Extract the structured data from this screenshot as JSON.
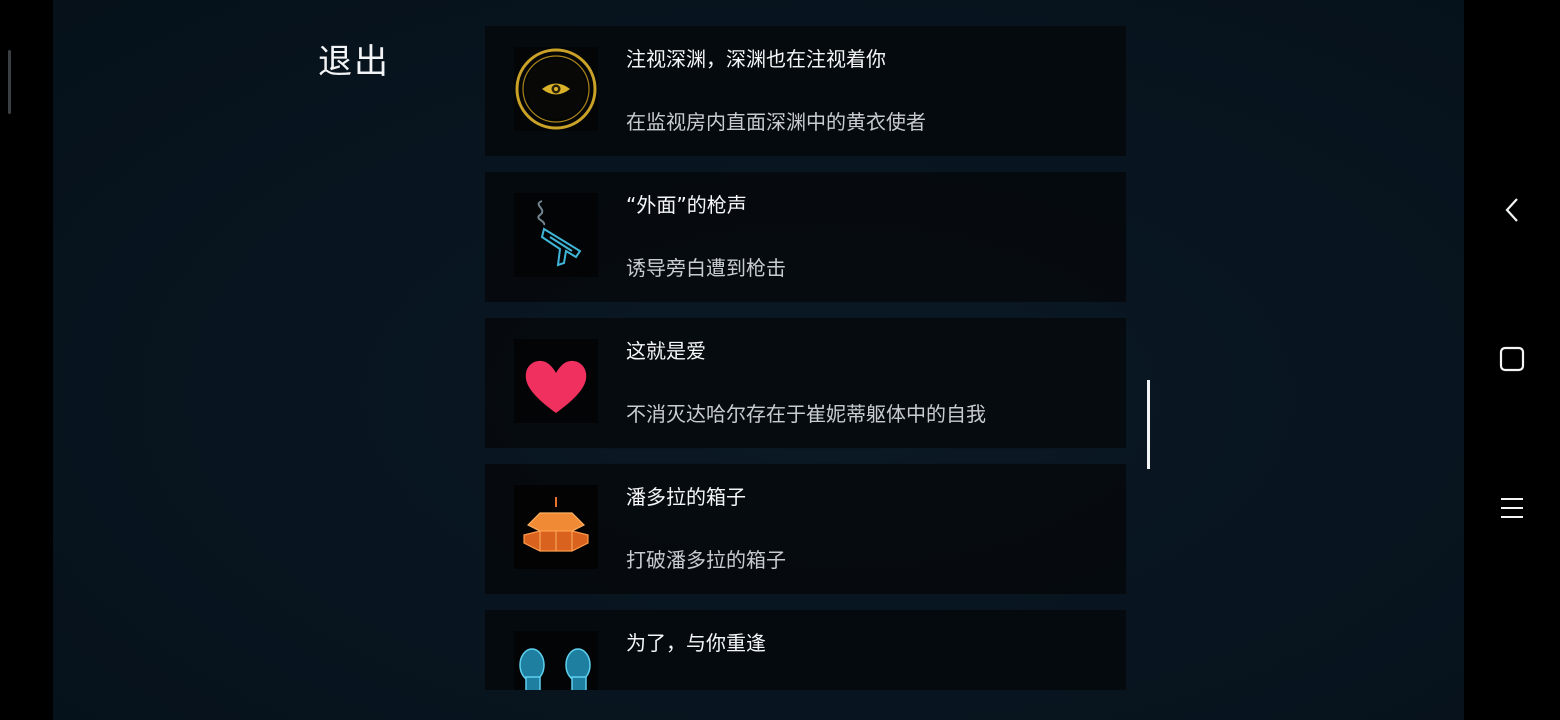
{
  "exit_label": "退出",
  "achievements": [
    {
      "icon": "eye-medallion-icon",
      "title": "注视深渊，深渊也在注视着你",
      "desc": "在监视房内直面深渊中的黄衣使者"
    },
    {
      "icon": "smoking-pistol-icon",
      "title": "“外面”的枪声",
      "desc": "诱导旁白遭到枪击"
    },
    {
      "icon": "heart-icon",
      "title": "这就是爱",
      "desc": "不消灭达哈尔存在于崔妮蒂躯体中的自我"
    },
    {
      "icon": "pandora-box-icon",
      "title": "潘多拉的箱子",
      "desc": "打破潘多拉的箱子"
    },
    {
      "icon": "twin-figures-icon",
      "title": "为了，与你重逢",
      "desc": ""
    }
  ],
  "colors": {
    "accent_gold": "#c9a227",
    "heart": "#f0305e",
    "box_orange": "#e8732a",
    "cyan": "#3fb6d8"
  }
}
